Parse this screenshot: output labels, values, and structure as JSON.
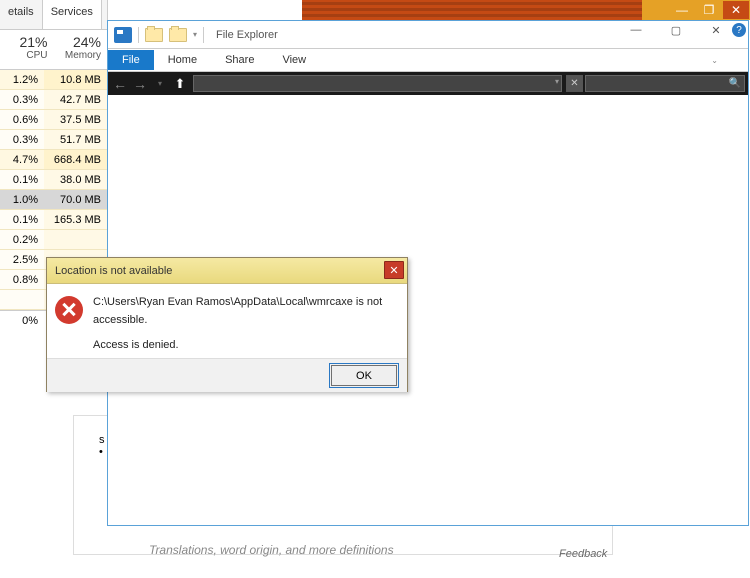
{
  "task_manager": {
    "tabs": {
      "details": "etails",
      "services": "Services"
    },
    "header": {
      "cpu_pct": "21%",
      "cpu_lbl": "CPU",
      "mem_pct": "24%",
      "mem_lbl": "Memory"
    },
    "rows": [
      {
        "cpu": "1.2%",
        "mem": "10.8 MB"
      },
      {
        "cpu": "0.3%",
        "mem": "42.7 MB"
      },
      {
        "cpu": "0.6%",
        "mem": "37.5 MB"
      },
      {
        "cpu": "0.3%",
        "mem": "51.7 MB"
      },
      {
        "cpu": "4.7%",
        "mem": "668.4 MB"
      },
      {
        "cpu": "0.1%",
        "mem": "38.0 MB"
      },
      {
        "cpu": "1.0%",
        "mem": "70.0 MB"
      },
      {
        "cpu": "0.1%",
        "mem": "165.3 MB"
      },
      {
        "cpu": "0.2%",
        "mem": ""
      },
      {
        "cpu": "2.5%",
        "mem": ""
      },
      {
        "cpu": "0.8%",
        "mem": ""
      }
    ],
    "last": {
      "cpu": "0%",
      "mem": ""
    }
  },
  "explorer": {
    "title": "File Explorer",
    "tabs": {
      "file": "File",
      "home": "Home",
      "share": "Share",
      "view": "View"
    },
    "win": {
      "min": "—",
      "max": "▢",
      "close": "✕",
      "help": "?"
    },
    "nav": {
      "back": "←",
      "fwd": "→",
      "up": "⬆"
    }
  },
  "bgwin": {
    "min": "—",
    "max": "❐",
    "close": "✕"
  },
  "dialog": {
    "title": "Location is not available",
    "line1": "C:\\Users\\Ryan Evan Ramos\\AppData\\Local\\wmrcaxe is not accessible.",
    "line2": "Access is denied.",
    "ok": "OK",
    "close": "✕"
  },
  "strip": {
    "s": "s",
    "txt": "Translations, word origin, and more definitions",
    "feedback": "Feedback"
  }
}
